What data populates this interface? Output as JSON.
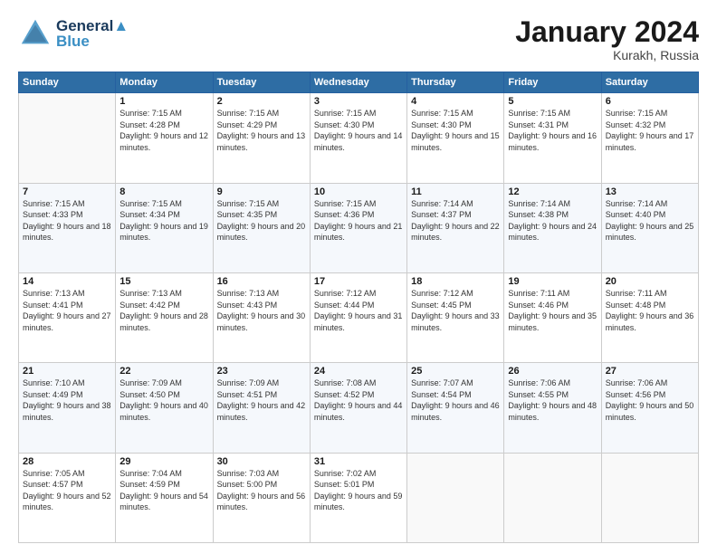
{
  "header": {
    "logo_top": "General",
    "logo_bottom": "Blue",
    "month_title": "January 2024",
    "location": "Kurakh, Russia"
  },
  "days_of_week": [
    "Sunday",
    "Monday",
    "Tuesday",
    "Wednesday",
    "Thursday",
    "Friday",
    "Saturday"
  ],
  "weeks": [
    [
      {
        "day": "",
        "content": ""
      },
      {
        "day": "1",
        "sunrise": "Sunrise: 7:15 AM",
        "sunset": "Sunset: 4:28 PM",
        "daylight": "Daylight: 9 hours and 12 minutes."
      },
      {
        "day": "2",
        "sunrise": "Sunrise: 7:15 AM",
        "sunset": "Sunset: 4:29 PM",
        "daylight": "Daylight: 9 hours and 13 minutes."
      },
      {
        "day": "3",
        "sunrise": "Sunrise: 7:15 AM",
        "sunset": "Sunset: 4:30 PM",
        "daylight": "Daylight: 9 hours and 14 minutes."
      },
      {
        "day": "4",
        "sunrise": "Sunrise: 7:15 AM",
        "sunset": "Sunset: 4:30 PM",
        "daylight": "Daylight: 9 hours and 15 minutes."
      },
      {
        "day": "5",
        "sunrise": "Sunrise: 7:15 AM",
        "sunset": "Sunset: 4:31 PM",
        "daylight": "Daylight: 9 hours and 16 minutes."
      },
      {
        "day": "6",
        "sunrise": "Sunrise: 7:15 AM",
        "sunset": "Sunset: 4:32 PM",
        "daylight": "Daylight: 9 hours and 17 minutes."
      }
    ],
    [
      {
        "day": "7",
        "sunrise": "Sunrise: 7:15 AM",
        "sunset": "Sunset: 4:33 PM",
        "daylight": "Daylight: 9 hours and 18 minutes."
      },
      {
        "day": "8",
        "sunrise": "Sunrise: 7:15 AM",
        "sunset": "Sunset: 4:34 PM",
        "daylight": "Daylight: 9 hours and 19 minutes."
      },
      {
        "day": "9",
        "sunrise": "Sunrise: 7:15 AM",
        "sunset": "Sunset: 4:35 PM",
        "daylight": "Daylight: 9 hours and 20 minutes."
      },
      {
        "day": "10",
        "sunrise": "Sunrise: 7:15 AM",
        "sunset": "Sunset: 4:36 PM",
        "daylight": "Daylight: 9 hours and 21 minutes."
      },
      {
        "day": "11",
        "sunrise": "Sunrise: 7:14 AM",
        "sunset": "Sunset: 4:37 PM",
        "daylight": "Daylight: 9 hours and 22 minutes."
      },
      {
        "day": "12",
        "sunrise": "Sunrise: 7:14 AM",
        "sunset": "Sunset: 4:38 PM",
        "daylight": "Daylight: 9 hours and 24 minutes."
      },
      {
        "day": "13",
        "sunrise": "Sunrise: 7:14 AM",
        "sunset": "Sunset: 4:40 PM",
        "daylight": "Daylight: 9 hours and 25 minutes."
      }
    ],
    [
      {
        "day": "14",
        "sunrise": "Sunrise: 7:13 AM",
        "sunset": "Sunset: 4:41 PM",
        "daylight": "Daylight: 9 hours and 27 minutes."
      },
      {
        "day": "15",
        "sunrise": "Sunrise: 7:13 AM",
        "sunset": "Sunset: 4:42 PM",
        "daylight": "Daylight: 9 hours and 28 minutes."
      },
      {
        "day": "16",
        "sunrise": "Sunrise: 7:13 AM",
        "sunset": "Sunset: 4:43 PM",
        "daylight": "Daylight: 9 hours and 30 minutes."
      },
      {
        "day": "17",
        "sunrise": "Sunrise: 7:12 AM",
        "sunset": "Sunset: 4:44 PM",
        "daylight": "Daylight: 9 hours and 31 minutes."
      },
      {
        "day": "18",
        "sunrise": "Sunrise: 7:12 AM",
        "sunset": "Sunset: 4:45 PM",
        "daylight": "Daylight: 9 hours and 33 minutes."
      },
      {
        "day": "19",
        "sunrise": "Sunrise: 7:11 AM",
        "sunset": "Sunset: 4:46 PM",
        "daylight": "Daylight: 9 hours and 35 minutes."
      },
      {
        "day": "20",
        "sunrise": "Sunrise: 7:11 AM",
        "sunset": "Sunset: 4:48 PM",
        "daylight": "Daylight: 9 hours and 36 minutes."
      }
    ],
    [
      {
        "day": "21",
        "sunrise": "Sunrise: 7:10 AM",
        "sunset": "Sunset: 4:49 PM",
        "daylight": "Daylight: 9 hours and 38 minutes."
      },
      {
        "day": "22",
        "sunrise": "Sunrise: 7:09 AM",
        "sunset": "Sunset: 4:50 PM",
        "daylight": "Daylight: 9 hours and 40 minutes."
      },
      {
        "day": "23",
        "sunrise": "Sunrise: 7:09 AM",
        "sunset": "Sunset: 4:51 PM",
        "daylight": "Daylight: 9 hours and 42 minutes."
      },
      {
        "day": "24",
        "sunrise": "Sunrise: 7:08 AM",
        "sunset": "Sunset: 4:52 PM",
        "daylight": "Daylight: 9 hours and 44 minutes."
      },
      {
        "day": "25",
        "sunrise": "Sunrise: 7:07 AM",
        "sunset": "Sunset: 4:54 PM",
        "daylight": "Daylight: 9 hours and 46 minutes."
      },
      {
        "day": "26",
        "sunrise": "Sunrise: 7:06 AM",
        "sunset": "Sunset: 4:55 PM",
        "daylight": "Daylight: 9 hours and 48 minutes."
      },
      {
        "day": "27",
        "sunrise": "Sunrise: 7:06 AM",
        "sunset": "Sunset: 4:56 PM",
        "daylight": "Daylight: 9 hours and 50 minutes."
      }
    ],
    [
      {
        "day": "28",
        "sunrise": "Sunrise: 7:05 AM",
        "sunset": "Sunset: 4:57 PM",
        "daylight": "Daylight: 9 hours and 52 minutes."
      },
      {
        "day": "29",
        "sunrise": "Sunrise: 7:04 AM",
        "sunset": "Sunset: 4:59 PM",
        "daylight": "Daylight: 9 hours and 54 minutes."
      },
      {
        "day": "30",
        "sunrise": "Sunrise: 7:03 AM",
        "sunset": "Sunset: 5:00 PM",
        "daylight": "Daylight: 9 hours and 56 minutes."
      },
      {
        "day": "31",
        "sunrise": "Sunrise: 7:02 AM",
        "sunset": "Sunset: 5:01 PM",
        "daylight": "Daylight: 9 hours and 59 minutes."
      },
      {
        "day": "",
        "content": ""
      },
      {
        "day": "",
        "content": ""
      },
      {
        "day": "",
        "content": ""
      }
    ]
  ]
}
